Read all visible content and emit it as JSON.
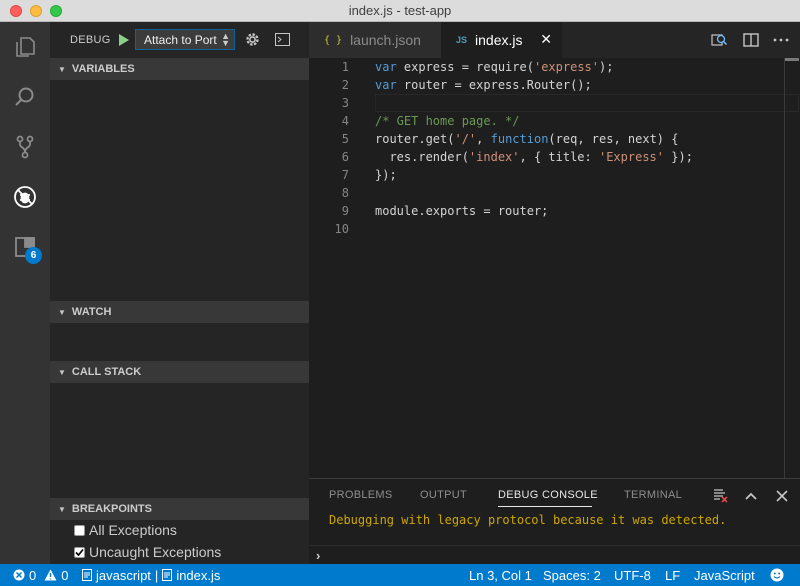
{
  "window": {
    "title": "index.js - test-app"
  },
  "activity": {
    "extensions_badge": "6"
  },
  "debug": {
    "label": "DEBUG",
    "config": "Attach to Port",
    "sections": {
      "variables": "VARIABLES",
      "watch": "WATCH",
      "call_stack": "CALL STACK",
      "breakpoints": "BREAKPOINTS"
    },
    "breakpoints": [
      {
        "label": "All Exceptions",
        "checked": false
      },
      {
        "label": "Uncaught Exceptions",
        "checked": true
      }
    ]
  },
  "tabs": [
    {
      "label": "launch.json",
      "icon": "{ }"
    },
    {
      "label": "index.js",
      "icon": "JS"
    }
  ],
  "editor": {
    "line_numbers": [
      "1",
      "2",
      "3",
      "4",
      "5",
      "6",
      "7",
      "8",
      "9",
      "10"
    ]
  },
  "panel": {
    "tabs": [
      "PROBLEMS",
      "OUTPUT",
      "DEBUG CONSOLE",
      "TERMINAL"
    ],
    "message": "Debugging with legacy protocol because it was detected.",
    "prompt": "›"
  },
  "status": {
    "errors": "0",
    "warnings": "0",
    "language_left": "javascript",
    "separator": "|",
    "file": "index.js",
    "position": "Ln 3, Col 1",
    "spaces": "Spaces: 2",
    "encoding": "UTF-8",
    "eol": "LF",
    "language": "JavaScript"
  },
  "colors": {
    "accent": "#007acc",
    "keyword": "#569cd6",
    "string": "#ce9178",
    "comment": "#6a9955",
    "warning": "#cca700"
  }
}
